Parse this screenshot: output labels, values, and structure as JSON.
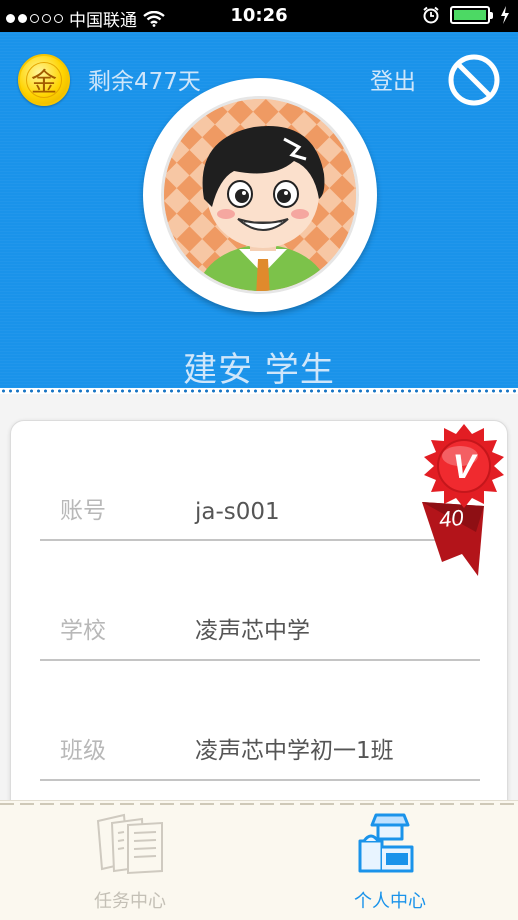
{
  "status_bar": {
    "carrier": "中国联通",
    "time": "10:26"
  },
  "header": {
    "coin_label": "金",
    "remaining_days": "剩余477天",
    "logout_label": "登出",
    "user_name": "建安 学生",
    "accent_color": "#1a93ea"
  },
  "vip_badge": {
    "letter": "V",
    "level": "40"
  },
  "profile": {
    "rows": [
      {
        "label": "账号",
        "value": "ja-s001"
      },
      {
        "label": "学校",
        "value": "凌声芯中学"
      },
      {
        "label": "班级",
        "value": "凌声芯中学初一1班"
      }
    ]
  },
  "tabbar": {
    "tabs": [
      {
        "label": "任务中心",
        "icon": "documents-icon",
        "active": false
      },
      {
        "label": "个人中心",
        "icon": "person-box-icon",
        "active": true
      }
    ]
  }
}
